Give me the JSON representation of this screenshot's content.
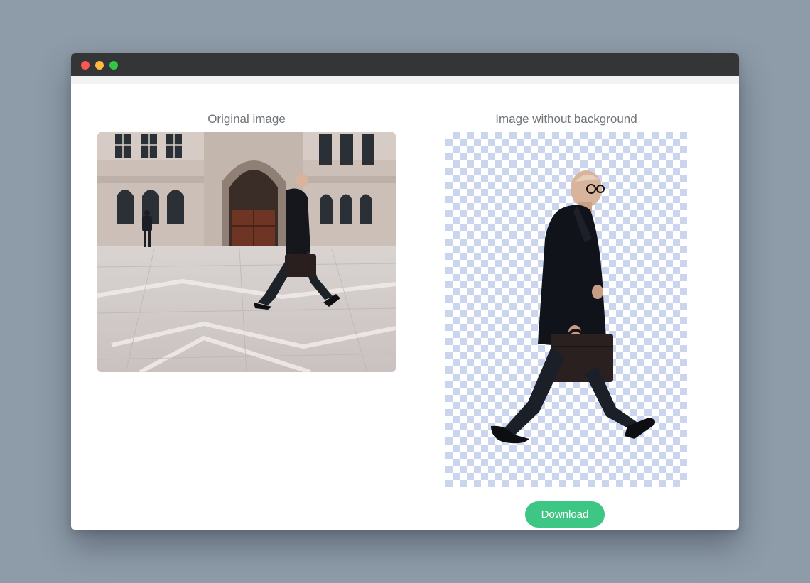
{
  "window": {
    "traffic_lights": [
      "close",
      "minimize",
      "zoom"
    ]
  },
  "panels": {
    "original": {
      "caption": "Original image"
    },
    "result": {
      "caption": "Image without background",
      "transparency_pattern_color": "#cbd6ee"
    }
  },
  "actions": {
    "download_label": "Download",
    "download_color": "#3ec784"
  }
}
